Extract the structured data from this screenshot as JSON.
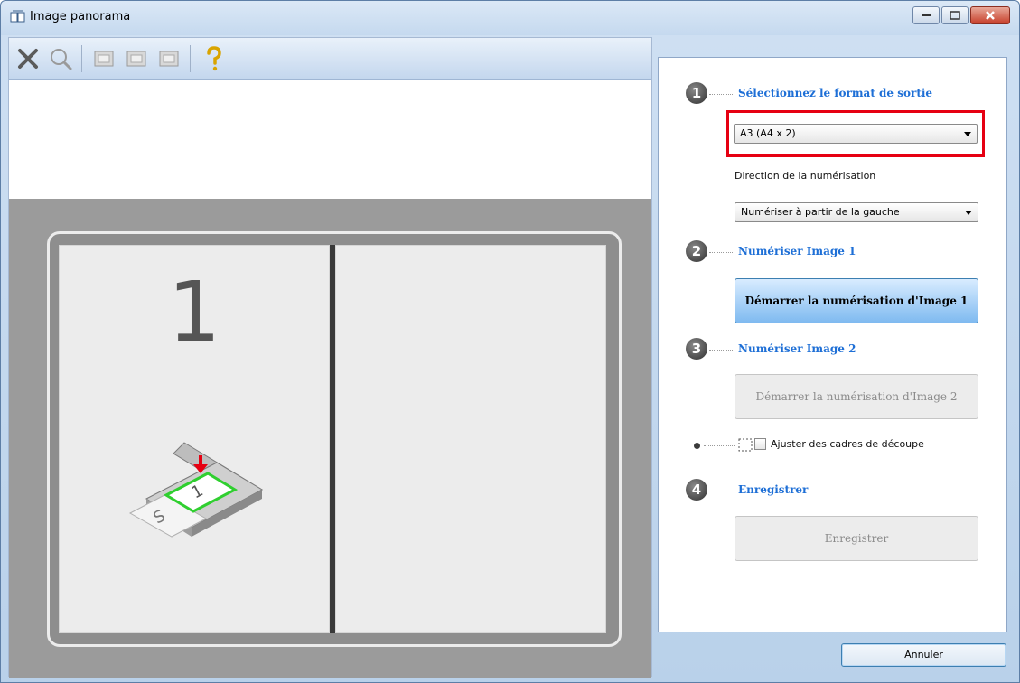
{
  "window": {
    "title": "Image panorama"
  },
  "toolbar": {
    "icons": [
      "delete-icon",
      "magnifier-icon",
      "scanner-icon",
      "scanner-icon-2",
      "scanner-icon-3",
      "help-icon"
    ]
  },
  "preview": {
    "panel1_number": "1"
  },
  "steps": {
    "step1": {
      "number": "1",
      "title": "Sélectionnez le format de sortie",
      "format_value": "A3 (A4 x 2)",
      "direction_label": "Direction de la numérisation",
      "direction_value": "Numériser à partir de la gauche"
    },
    "step2": {
      "number": "2",
      "title": "Numériser Image 1",
      "button": "Démarrer la numérisation d'Image 1"
    },
    "step3": {
      "number": "3",
      "title": "Numériser Image 2",
      "button": "Démarrer la numérisation d'Image 2"
    },
    "crop": {
      "label": "Ajuster des cadres de découpe",
      "checked": false
    },
    "step4": {
      "number": "4",
      "title": "Enregistrer",
      "button": "Enregistrer"
    }
  },
  "footer": {
    "cancel": "Annuler"
  },
  "colors": {
    "accent": "#1e6fd6",
    "highlight": "#e60012",
    "primary_button": "#7fbaf0"
  }
}
